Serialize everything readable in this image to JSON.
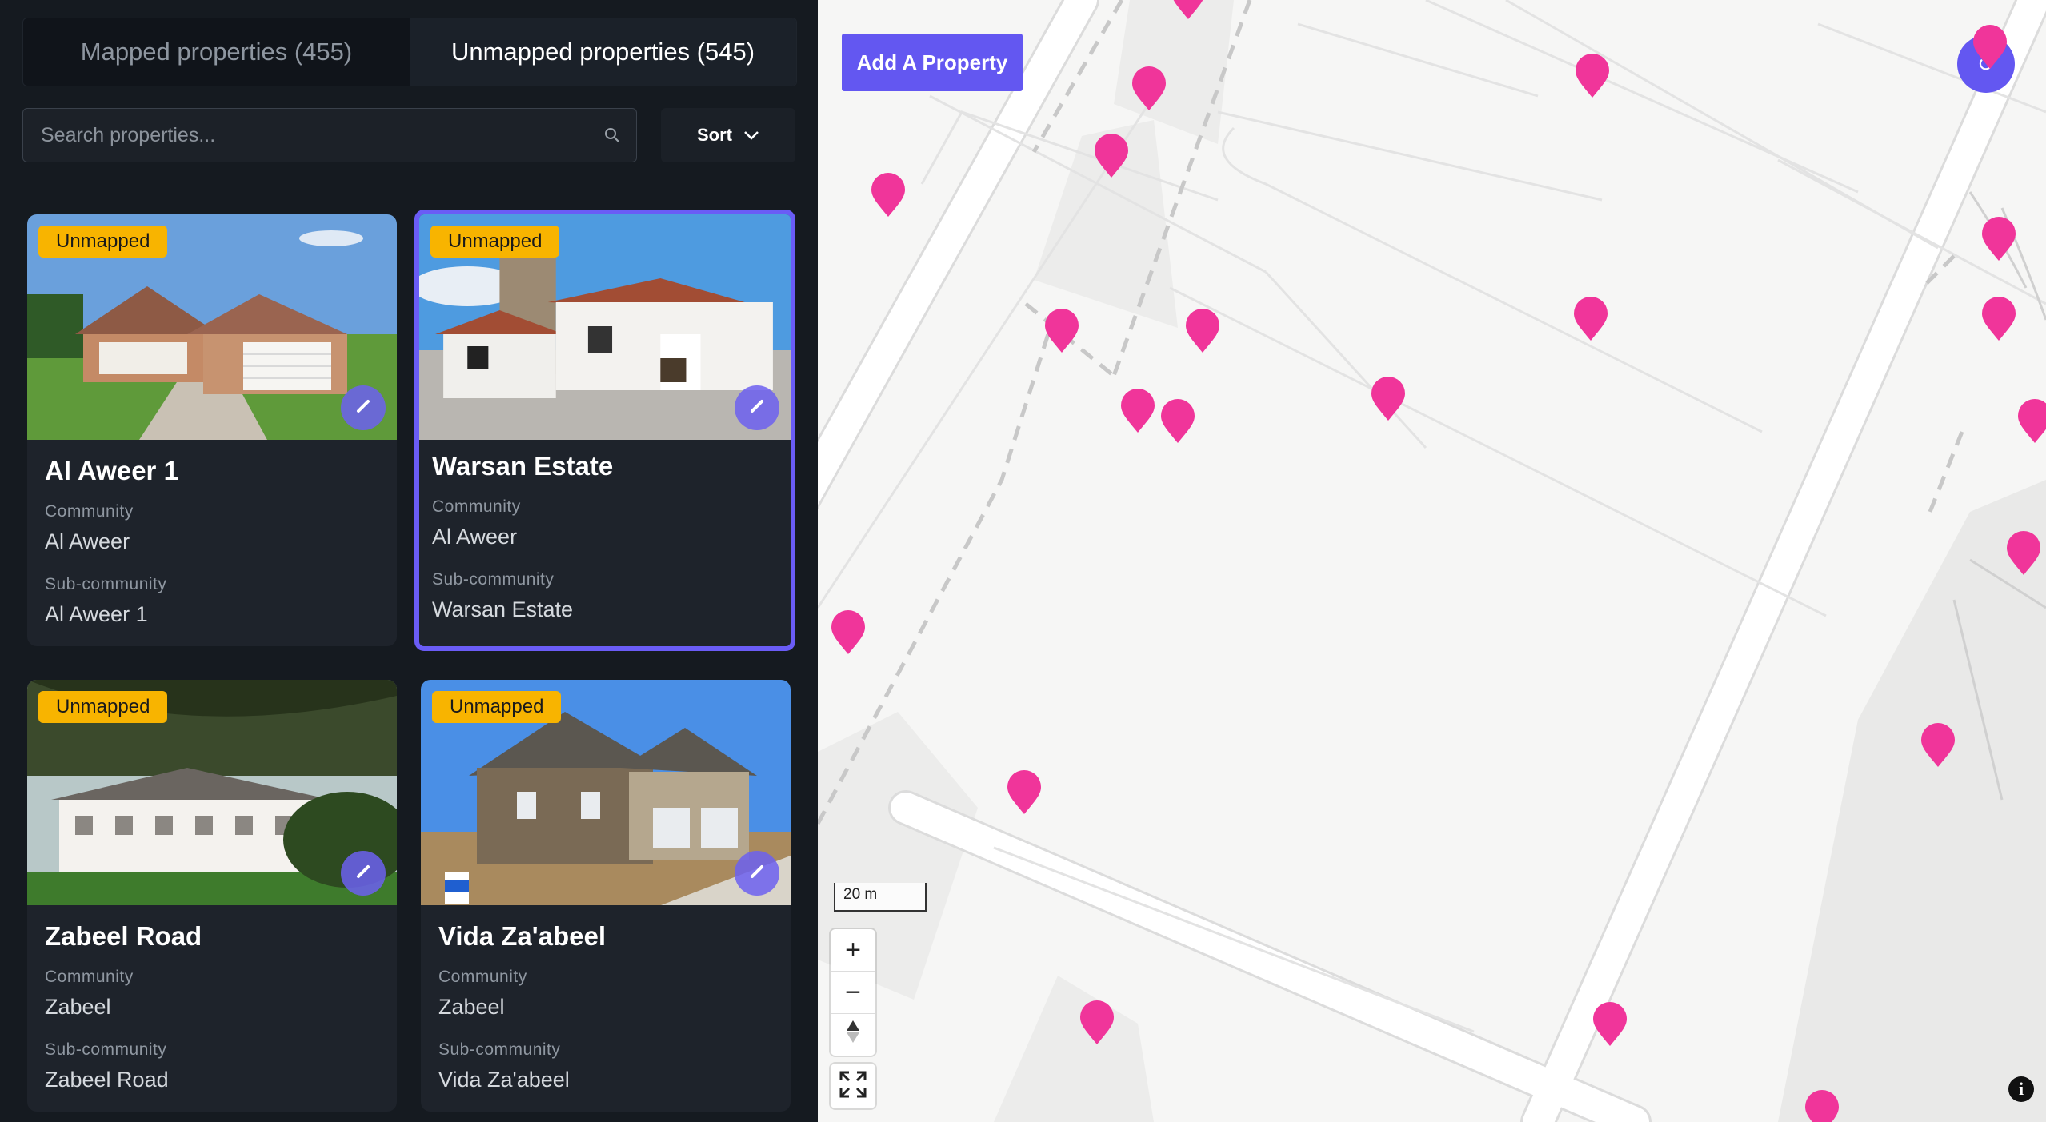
{
  "tabs": [
    {
      "label": "Mapped properties (455)",
      "active": false
    },
    {
      "label": "Unmapped properties (545)",
      "active": true
    }
  ],
  "search": {
    "placeholder": "Search properties..."
  },
  "sort": {
    "label": "Sort"
  },
  "cards": [
    {
      "badge": "Unmapped",
      "title": "Al Aweer 1",
      "community_label": "Community",
      "community": "Al Aweer",
      "subcommunity_label": "Sub-community",
      "subcommunity": "Al Aweer 1",
      "selected": false
    },
    {
      "badge": "Unmapped",
      "title": "Warsan Estate",
      "community_label": "Community",
      "community": "Al Aweer",
      "subcommunity_label": "Sub-community",
      "subcommunity": "Warsan Estate",
      "selected": true
    },
    {
      "badge": "Unmapped",
      "title": "Zabeel Road",
      "community_label": "Community",
      "community": "Zabeel",
      "subcommunity_label": "Sub-community",
      "subcommunity": "Zabeel Road",
      "selected": false
    },
    {
      "badge": "Unmapped",
      "title": "Vida Za'abeel",
      "community_label": "Community",
      "community": "Zabeel",
      "subcommunity_label": "Sub-community",
      "subcommunity": "Vida Za'abeel",
      "selected": false
    }
  ],
  "map": {
    "add_button": "Add A Property",
    "scale_label": "20 m",
    "pin_color": "#f0359a",
    "accent": "#6357f1"
  },
  "colors": {
    "badge": "#f8b400",
    "panel_bg": "#151a20",
    "card_bg": "#1e232b",
    "selected_border": "#6a5cf6"
  }
}
